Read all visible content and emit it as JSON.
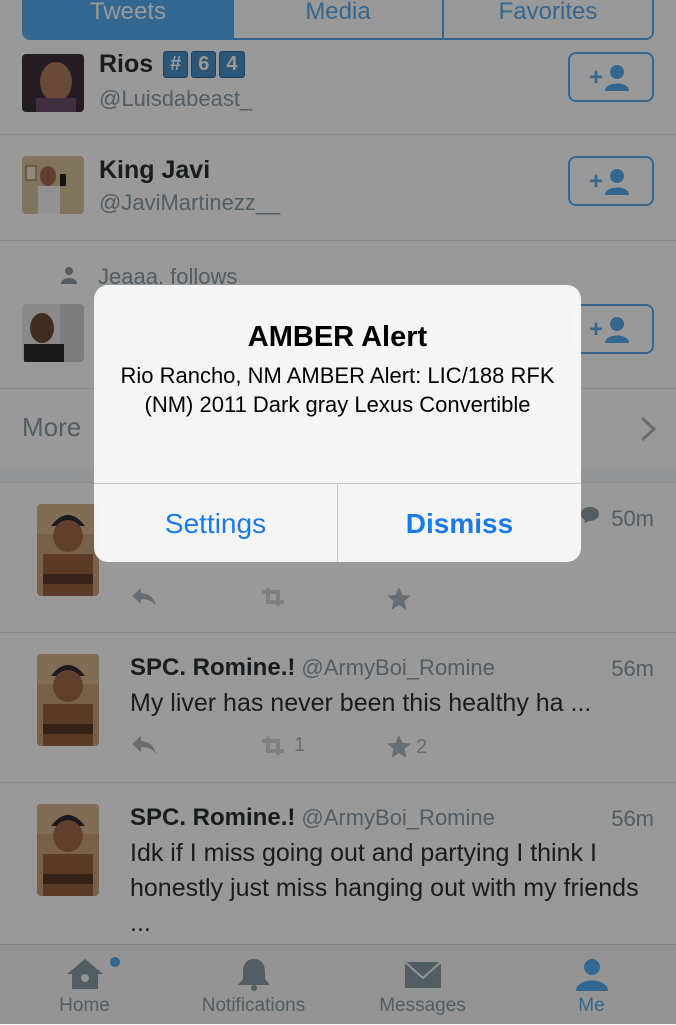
{
  "segmented": {
    "tabs": [
      "Tweets",
      "Media",
      "Favorites"
    ]
  },
  "suggestions": [
    {
      "name": "Rios",
      "badges": [
        "#",
        "6",
        "4"
      ],
      "handle": "@Luisdabeast_"
    },
    {
      "name": "King Javi",
      "handle": "@JaviMartinezz__"
    },
    {
      "context": "Jeaaa. follows"
    }
  ],
  "more_label": "More",
  "tweets": [
    {
      "time": "50m"
    },
    {
      "name": "SPC. Romine.!",
      "handle": "@ArmyBoi_Romine",
      "time": "56m",
      "text": "My liver has never been this healthy ha ...",
      "retweets": "1",
      "favorites": "2"
    },
    {
      "name": "SPC. Romine.!",
      "handle": "@ArmyBoi_Romine",
      "time": "56m",
      "text": "Idk if I miss going out and partying I think I honestly just miss hanging out with my friends ..."
    }
  ],
  "tabbar": [
    {
      "label": "Home",
      "icon": "home-icon"
    },
    {
      "label": "Notifications",
      "icon": "bell-icon"
    },
    {
      "label": "Messages",
      "icon": "envelope-icon"
    },
    {
      "label": "Me",
      "icon": "person-icon"
    }
  ],
  "alert": {
    "title": "AMBER Alert",
    "message": "Rio Rancho, NM AMBER Alert: LIC/188 RFK (NM) 2011 Dark gray Lexus Convertible",
    "buttons": [
      "Settings",
      "Dismiss"
    ]
  },
  "colors": {
    "accent": "#55acee",
    "alert_button": "#1a7ae6",
    "secondary_text": "#8899a6"
  }
}
